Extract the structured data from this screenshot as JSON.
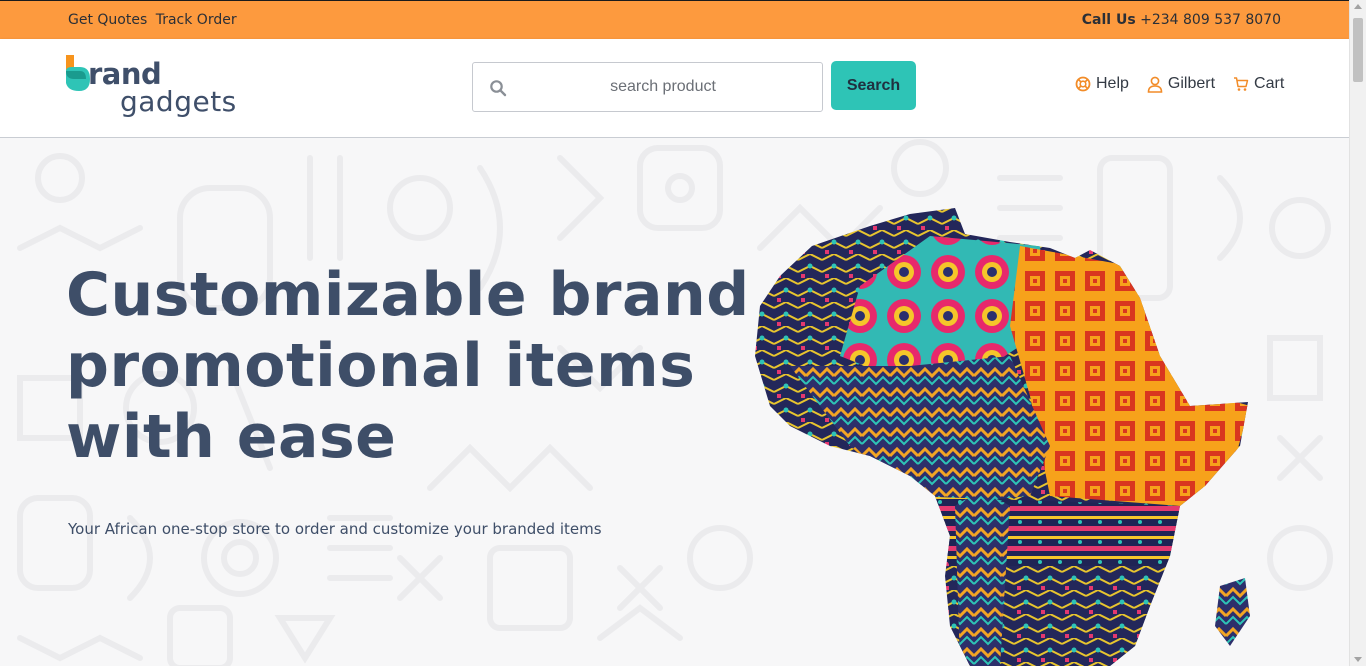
{
  "topbar": {
    "links": [
      "Get Quotes",
      "Track Order"
    ],
    "call_label": "Call Us",
    "phone": "+234 809 537 8070"
  },
  "header": {
    "logo": {
      "line1": "rand",
      "line2": "gadgets"
    },
    "search": {
      "placeholder": "search product",
      "value": "",
      "button_label": "Search"
    },
    "nav": {
      "help": "Help",
      "user": "Gilbert",
      "cart": "Cart"
    }
  },
  "hero": {
    "title": "Customizable brand promotional items with ease",
    "subtitle": "Your African one-stop store to order and customize your branded items"
  },
  "colors": {
    "topbar": "#fd9a3e",
    "accent": "#2ec4b6",
    "heading": "#3e4e68",
    "icon_orange": "#f28c28"
  },
  "icons": [
    "search-icon",
    "help-lifebuoy-icon",
    "user-icon",
    "cart-icon"
  ]
}
